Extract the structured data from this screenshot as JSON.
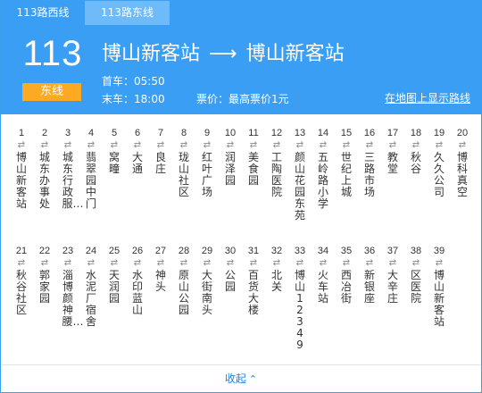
{
  "tabs": [
    {
      "label": "113路西线"
    },
    {
      "label": "113路东线"
    }
  ],
  "header": {
    "route_number": "113",
    "direction": "东线",
    "from_station": "博山新客站",
    "arrow": "⟶",
    "to_station": "博山新客站",
    "first_bus": "首车：05:50",
    "last_bus": "末车：18:00",
    "fare": "票价：最高票价1元",
    "map_link": "在地图上显示路线"
  },
  "stops": [
    {
      "num": "1",
      "name": "博山新客站"
    },
    {
      "num": "2",
      "name": "城东办事处"
    },
    {
      "num": "3",
      "name": "城东行政服…"
    },
    {
      "num": "4",
      "name": "翡翠园中门"
    },
    {
      "num": "5",
      "name": "窝疃"
    },
    {
      "num": "6",
      "name": "大通"
    },
    {
      "num": "7",
      "name": "良庄"
    },
    {
      "num": "8",
      "name": "珑山社区"
    },
    {
      "num": "9",
      "name": "红叶广场"
    },
    {
      "num": "10",
      "name": "润泽园"
    },
    {
      "num": "11",
      "name": "美食园"
    },
    {
      "num": "12",
      "name": "工陶医院"
    },
    {
      "num": "13",
      "name": "颜山花园东苑"
    },
    {
      "num": "14",
      "name": "五岭路小学"
    },
    {
      "num": "15",
      "name": "世纪上城"
    },
    {
      "num": "16",
      "name": "三路市场"
    },
    {
      "num": "17",
      "name": "教堂"
    },
    {
      "num": "18",
      "name": "秋谷"
    },
    {
      "num": "19",
      "name": "久久公司"
    },
    {
      "num": "20",
      "name": "博科真空"
    },
    {
      "num": "21",
      "name": "秋谷社区"
    },
    {
      "num": "22",
      "name": "郭家园"
    },
    {
      "num": "23",
      "name": "淄博颜神腰…"
    },
    {
      "num": "24",
      "name": "水泥厂宿舍"
    },
    {
      "num": "25",
      "name": "天润园"
    },
    {
      "num": "26",
      "name": "水印蓝山"
    },
    {
      "num": "27",
      "name": "神头"
    },
    {
      "num": "28",
      "name": "原山公园"
    },
    {
      "num": "29",
      "name": "大街南头"
    },
    {
      "num": "30",
      "name": "公园"
    },
    {
      "num": "31",
      "name": "百货大楼"
    },
    {
      "num": "32",
      "name": "北关"
    },
    {
      "num": "33",
      "name": "博山12349"
    },
    {
      "num": "34",
      "name": "火车站"
    },
    {
      "num": "35",
      "name": "西冶街"
    },
    {
      "num": "36",
      "name": "新银座"
    },
    {
      "num": "37",
      "name": "大辛庄"
    },
    {
      "num": "38",
      "name": "区医院"
    },
    {
      "num": "39",
      "name": "博山新客站"
    }
  ],
  "dir_icon": "⇄",
  "footer": {
    "label": "收起",
    "chevron": "⌃"
  }
}
